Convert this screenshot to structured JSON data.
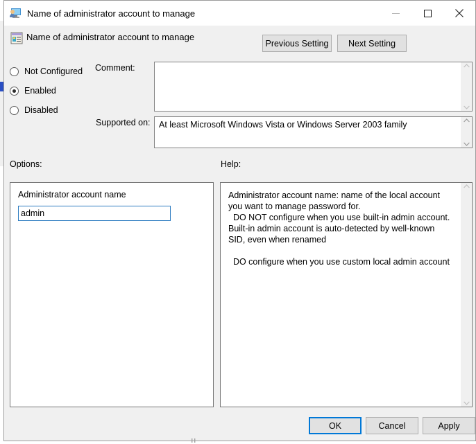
{
  "window": {
    "title": "Name of administrator account to manage",
    "title_icon": "computer-user-icon",
    "controls": {
      "minimize": "minimize-icon",
      "maximize": "maximize-icon",
      "close": "close-icon"
    }
  },
  "header": {
    "policy_icon": "policy-setting-icon",
    "policy_title": "Name of administrator account to manage",
    "previous_button": "Previous Setting",
    "next_button": "Next Setting"
  },
  "state": {
    "options": [
      {
        "label": "Not Configured",
        "selected": false
      },
      {
        "label": "Enabled",
        "selected": true
      },
      {
        "label": "Disabled",
        "selected": false
      }
    ]
  },
  "comment": {
    "label": "Comment:",
    "value": ""
  },
  "supported": {
    "label": "Supported on:",
    "value": "At least Microsoft Windows Vista or Windows Server 2003 family"
  },
  "options_pane": {
    "label": "Options:",
    "field_label": "Administrator account name",
    "input_value": "admin"
  },
  "help_pane": {
    "label": "Help:",
    "text": "Administrator account name: name of the local account you want to manage password for.\n  DO NOT configure when you use built-in admin account. Built-in admin account is auto-detected by well-known SID, even when renamed\n\n  DO configure when you use custom local admin account"
  },
  "footer": {
    "ok": "OK",
    "cancel": "Cancel",
    "apply": "Apply"
  },
  "colors": {
    "accent": "#0078d7",
    "dialog_bg": "#f0f0f0",
    "button_bg": "#e1e1e1",
    "input_focus_border": "#2a7ac0"
  }
}
